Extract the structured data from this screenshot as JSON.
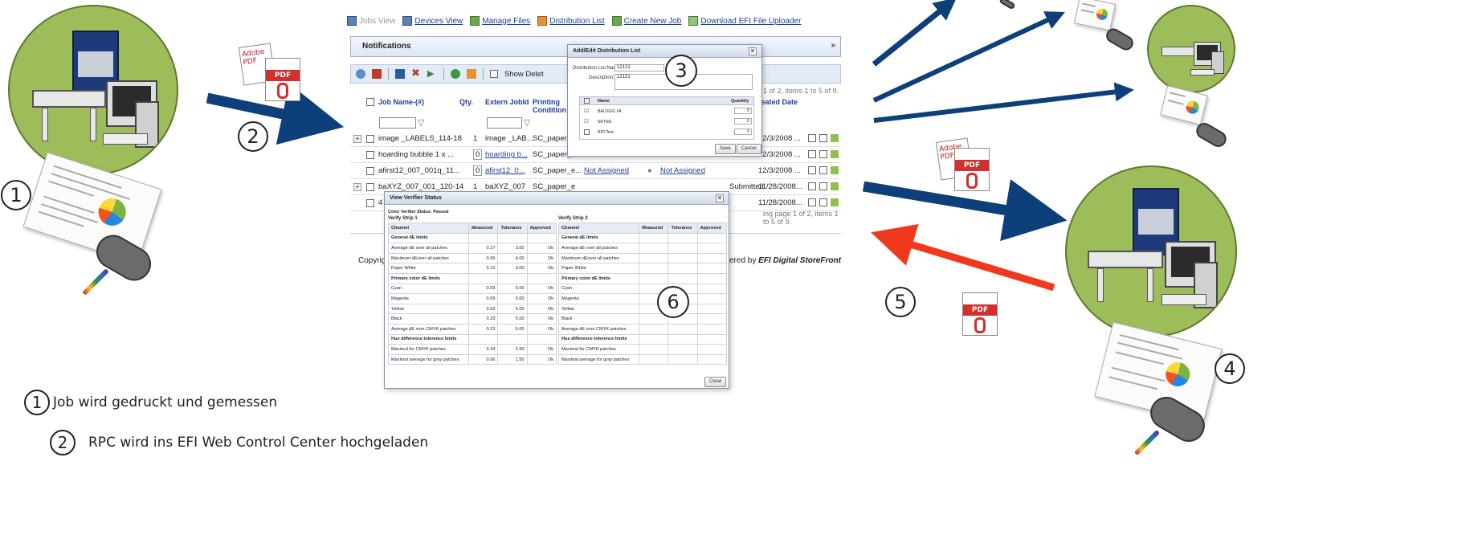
{
  "nav": {
    "jobs_view": "Jobs View",
    "devices_view": "Devices View",
    "manage_files": "Manage Files",
    "distribution_list": "Distribution List",
    "create_new_job": "Create New Job",
    "download_uploader": "Download EFI File Uploader"
  },
  "notifications": {
    "title": "Notifications"
  },
  "toolbar": {
    "show_deleted": "Show Delet",
    "paging_top": "1 of 2, items 1 to 5 of 9."
  },
  "grid": {
    "headers": {
      "job_name": "Job Name-(#)",
      "qty": "Qty.",
      "extern_jobid": "Extern JobId",
      "printing": "Printing",
      "condition": "Condition",
      "created": "reated Date"
    },
    "rows": [
      {
        "name": "image _LABELS_114-18",
        "qty": "1",
        "ext": "image _LAB...",
        "cond": "SC_paper_",
        "status": "",
        "assigned": "",
        "state": "",
        "date": "12/3/2008 ..."
      },
      {
        "name": "hoarding bubble 1 x ...",
        "qty": "0",
        "ext": "hoarding b...",
        "cond": "SC_paper_",
        "status": "",
        "assigned": "",
        "state": "",
        "date": "12/3/2008 ..."
      },
      {
        "name": "afirst12_007_001q_11...",
        "qty": "0",
        "ext": "afirst12_0...",
        "cond": "SC_paper_e...",
        "status": "Not Assigned",
        "assigned": "Not Assigned",
        "state": "",
        "date": "12/3/2008 ..."
      },
      {
        "name": "baXYZ_007_001_120-14",
        "qty": "1",
        "ext": "baXYZ_007",
        "cond": "SC_paper_e",
        "status": "",
        "assigned": "",
        "state": "Submitted",
        "date": "11/28/2008..."
      },
      {
        "name": "4",
        "qty": "",
        "ext": "",
        "cond": "",
        "status": "",
        "assigned": "",
        "state": "",
        "date": "11/28/2008..."
      }
    ],
    "paging_bottom": "ing page 1 of 2, items 1 to 5 of 9."
  },
  "footer": {
    "copyright": "Copyrig",
    "powered": "ered by",
    "brand": "EFI Digital StoreFront"
  },
  "dist_dialog": {
    "title": "Add/Edit Distribution List",
    "name_label": "Distribution List Name:",
    "name_value": "12121",
    "desc_label": "Description:",
    "desc_value": "12121",
    "col_name": "Name",
    "col_qty": "Quantity",
    "items": [
      {
        "name": "BALOGIC-04",
        "qty": "0",
        "checked": true
      },
      {
        "name": "NKTNG",
        "qty": "0",
        "checked": true
      },
      {
        "name": "RPCTest",
        "qty": "0",
        "checked": false
      }
    ],
    "save": "Save",
    "cancel": "Cancel"
  },
  "verifier": {
    "title": "View Verifier Status",
    "status": "Color Verifier Status: Passed",
    "strip1": "Verify Strip 1",
    "strip2": "Verify Strip 2",
    "headers": [
      "Channel",
      "Measured",
      "Tolerance",
      "Approved"
    ],
    "strip1_rows": [
      {
        "c": "General dE limits",
        "sec": true
      },
      {
        "c": "Average dE over all patches",
        "m": "0.27",
        "t": "3.00",
        "a": "Ok"
      },
      {
        "c": "Maximum dEover all patches",
        "m": "0.66",
        "t": "6.00",
        "a": "Ok"
      },
      {
        "c": "Paper White",
        "m": "0.12",
        "t": "3.00",
        "a": "Ok"
      },
      {
        "c": "Primary color dE limits",
        "sec": true
      },
      {
        "c": "Cyan",
        "m": "0.09",
        "t": "5.00",
        "a": "Ok"
      },
      {
        "c": "Magenta",
        "m": "0.09",
        "t": "5.00",
        "a": "Ok"
      },
      {
        "c": "Yellow",
        "m": "0.03",
        "t": "5.00",
        "a": "Ok"
      },
      {
        "c": "Black",
        "m": "0.23",
        "t": "5.00",
        "a": "Ok"
      },
      {
        "c": "Average dE over CMYK patches",
        "m": "0.23",
        "t": "5.00",
        "a": "Ok"
      },
      {
        "c": "Hue difference tolerence limits",
        "sec": true
      },
      {
        "c": "Maximal for CMYK patches",
        "m": "0.34",
        "t": "2.50",
        "a": "Ok"
      },
      {
        "c": "Maximal average for gray patches",
        "m": "0.06",
        "t": "1.50",
        "a": "Ok"
      }
    ],
    "strip2_rows": [
      {
        "c": "General dE limits",
        "sec": true
      },
      {
        "c": "Average dE over all patches"
      },
      {
        "c": "Maximum dEover all patches"
      },
      {
        "c": "Paper White"
      },
      {
        "c": "Primary color dE limits",
        "sec": true
      },
      {
        "c": "Cyan"
      },
      {
        "c": "Magenta"
      },
      {
        "c": "Yellow"
      },
      {
        "c": "Black"
      },
      {
        "c": "Average dE over CMYK patches"
      },
      {
        "c": "Hue difference tolerence limits",
        "sec": true
      },
      {
        "c": "Maximal for CMYK patches"
      },
      {
        "c": "Maximal average for gray patches"
      }
    ],
    "close": "Close"
  },
  "labels": {
    "n1": "1",
    "n2": "2",
    "n3": "3",
    "n4": "4",
    "n5": "5",
    "n6": "6"
  },
  "legend": [
    {
      "num": "1",
      "text": "Job wird gedruckt und gemessen"
    },
    {
      "num": "2",
      "text": "RPC wird ins EFI Web Control Center hochgeladen"
    }
  ],
  "icons": {
    "pdf": "PDF",
    "adobe": "Adobe PDF",
    "efi": "efi"
  },
  "colors": {
    "arrow_blue": "#0d3f7a",
    "arrow_red": "#f0391c",
    "station_green": "#9dbd5b"
  }
}
